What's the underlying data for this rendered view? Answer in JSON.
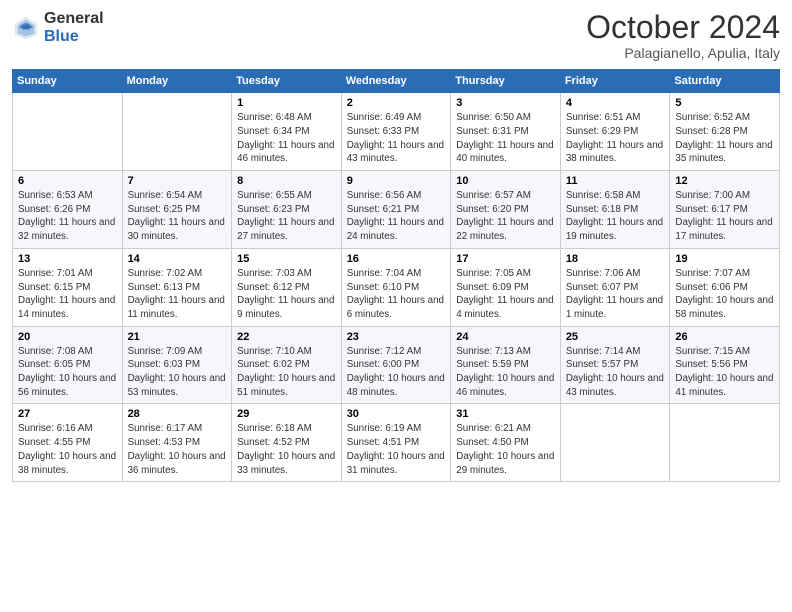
{
  "header": {
    "logo_general": "General",
    "logo_blue": "Blue",
    "month_title": "October 2024",
    "location": "Palagianello, Apulia, Italy"
  },
  "days_of_week": [
    "Sunday",
    "Monday",
    "Tuesday",
    "Wednesday",
    "Thursday",
    "Friday",
    "Saturday"
  ],
  "weeks": [
    [
      {
        "day": "",
        "sunrise": "",
        "sunset": "",
        "daylight": ""
      },
      {
        "day": "",
        "sunrise": "",
        "sunset": "",
        "daylight": ""
      },
      {
        "day": "1",
        "sunrise": "Sunrise: 6:48 AM",
        "sunset": "Sunset: 6:34 PM",
        "daylight": "Daylight: 11 hours and 46 minutes."
      },
      {
        "day": "2",
        "sunrise": "Sunrise: 6:49 AM",
        "sunset": "Sunset: 6:33 PM",
        "daylight": "Daylight: 11 hours and 43 minutes."
      },
      {
        "day": "3",
        "sunrise": "Sunrise: 6:50 AM",
        "sunset": "Sunset: 6:31 PM",
        "daylight": "Daylight: 11 hours and 40 minutes."
      },
      {
        "day": "4",
        "sunrise": "Sunrise: 6:51 AM",
        "sunset": "Sunset: 6:29 PM",
        "daylight": "Daylight: 11 hours and 38 minutes."
      },
      {
        "day": "5",
        "sunrise": "Sunrise: 6:52 AM",
        "sunset": "Sunset: 6:28 PM",
        "daylight": "Daylight: 11 hours and 35 minutes."
      }
    ],
    [
      {
        "day": "6",
        "sunrise": "Sunrise: 6:53 AM",
        "sunset": "Sunset: 6:26 PM",
        "daylight": "Daylight: 11 hours and 32 minutes."
      },
      {
        "day": "7",
        "sunrise": "Sunrise: 6:54 AM",
        "sunset": "Sunset: 6:25 PM",
        "daylight": "Daylight: 11 hours and 30 minutes."
      },
      {
        "day": "8",
        "sunrise": "Sunrise: 6:55 AM",
        "sunset": "Sunset: 6:23 PM",
        "daylight": "Daylight: 11 hours and 27 minutes."
      },
      {
        "day": "9",
        "sunrise": "Sunrise: 6:56 AM",
        "sunset": "Sunset: 6:21 PM",
        "daylight": "Daylight: 11 hours and 24 minutes."
      },
      {
        "day": "10",
        "sunrise": "Sunrise: 6:57 AM",
        "sunset": "Sunset: 6:20 PM",
        "daylight": "Daylight: 11 hours and 22 minutes."
      },
      {
        "day": "11",
        "sunrise": "Sunrise: 6:58 AM",
        "sunset": "Sunset: 6:18 PM",
        "daylight": "Daylight: 11 hours and 19 minutes."
      },
      {
        "day": "12",
        "sunrise": "Sunrise: 7:00 AM",
        "sunset": "Sunset: 6:17 PM",
        "daylight": "Daylight: 11 hours and 17 minutes."
      }
    ],
    [
      {
        "day": "13",
        "sunrise": "Sunrise: 7:01 AM",
        "sunset": "Sunset: 6:15 PM",
        "daylight": "Daylight: 11 hours and 14 minutes."
      },
      {
        "day": "14",
        "sunrise": "Sunrise: 7:02 AM",
        "sunset": "Sunset: 6:13 PM",
        "daylight": "Daylight: 11 hours and 11 minutes."
      },
      {
        "day": "15",
        "sunrise": "Sunrise: 7:03 AM",
        "sunset": "Sunset: 6:12 PM",
        "daylight": "Daylight: 11 hours and 9 minutes."
      },
      {
        "day": "16",
        "sunrise": "Sunrise: 7:04 AM",
        "sunset": "Sunset: 6:10 PM",
        "daylight": "Daylight: 11 hours and 6 minutes."
      },
      {
        "day": "17",
        "sunrise": "Sunrise: 7:05 AM",
        "sunset": "Sunset: 6:09 PM",
        "daylight": "Daylight: 11 hours and 4 minutes."
      },
      {
        "day": "18",
        "sunrise": "Sunrise: 7:06 AM",
        "sunset": "Sunset: 6:07 PM",
        "daylight": "Daylight: 11 hours and 1 minute."
      },
      {
        "day": "19",
        "sunrise": "Sunrise: 7:07 AM",
        "sunset": "Sunset: 6:06 PM",
        "daylight": "Daylight: 10 hours and 58 minutes."
      }
    ],
    [
      {
        "day": "20",
        "sunrise": "Sunrise: 7:08 AM",
        "sunset": "Sunset: 6:05 PM",
        "daylight": "Daylight: 10 hours and 56 minutes."
      },
      {
        "day": "21",
        "sunrise": "Sunrise: 7:09 AM",
        "sunset": "Sunset: 6:03 PM",
        "daylight": "Daylight: 10 hours and 53 minutes."
      },
      {
        "day": "22",
        "sunrise": "Sunrise: 7:10 AM",
        "sunset": "Sunset: 6:02 PM",
        "daylight": "Daylight: 10 hours and 51 minutes."
      },
      {
        "day": "23",
        "sunrise": "Sunrise: 7:12 AM",
        "sunset": "Sunset: 6:00 PM",
        "daylight": "Daylight: 10 hours and 48 minutes."
      },
      {
        "day": "24",
        "sunrise": "Sunrise: 7:13 AM",
        "sunset": "Sunset: 5:59 PM",
        "daylight": "Daylight: 10 hours and 46 minutes."
      },
      {
        "day": "25",
        "sunrise": "Sunrise: 7:14 AM",
        "sunset": "Sunset: 5:57 PM",
        "daylight": "Daylight: 10 hours and 43 minutes."
      },
      {
        "day": "26",
        "sunrise": "Sunrise: 7:15 AM",
        "sunset": "Sunset: 5:56 PM",
        "daylight": "Daylight: 10 hours and 41 minutes."
      }
    ],
    [
      {
        "day": "27",
        "sunrise": "Sunrise: 6:16 AM",
        "sunset": "Sunset: 4:55 PM",
        "daylight": "Daylight: 10 hours and 38 minutes."
      },
      {
        "day": "28",
        "sunrise": "Sunrise: 6:17 AM",
        "sunset": "Sunset: 4:53 PM",
        "daylight": "Daylight: 10 hours and 36 minutes."
      },
      {
        "day": "29",
        "sunrise": "Sunrise: 6:18 AM",
        "sunset": "Sunset: 4:52 PM",
        "daylight": "Daylight: 10 hours and 33 minutes."
      },
      {
        "day": "30",
        "sunrise": "Sunrise: 6:19 AM",
        "sunset": "Sunset: 4:51 PM",
        "daylight": "Daylight: 10 hours and 31 minutes."
      },
      {
        "day": "31",
        "sunrise": "Sunrise: 6:21 AM",
        "sunset": "Sunset: 4:50 PM",
        "daylight": "Daylight: 10 hours and 29 minutes."
      },
      {
        "day": "",
        "sunrise": "",
        "sunset": "",
        "daylight": ""
      },
      {
        "day": "",
        "sunrise": "",
        "sunset": "",
        "daylight": ""
      }
    ]
  ]
}
